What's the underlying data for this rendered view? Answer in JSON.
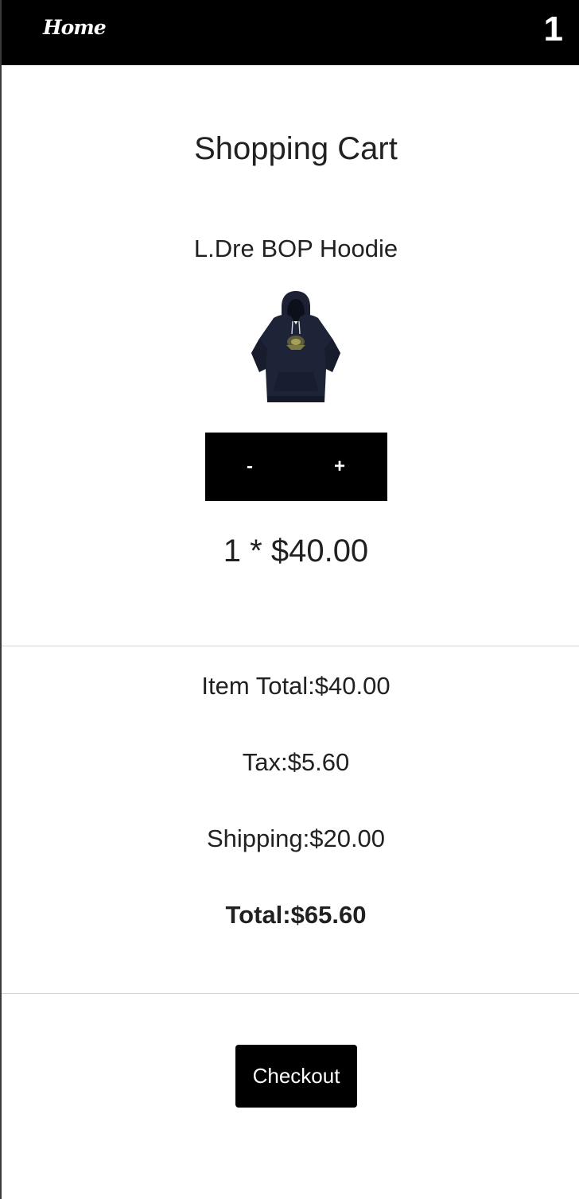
{
  "header": {
    "home_label": "Home",
    "cart_count": "1"
  },
  "page": {
    "title": "Shopping Cart"
  },
  "cart": {
    "items": [
      {
        "name": "L.Dre BOP Hoodie",
        "image_icon": "navy-hoodie-image",
        "decrement_label": "-",
        "increment_label": "+",
        "line_price": "1 * $40.00"
      }
    ]
  },
  "summary": {
    "item_total": "Item Total:$40.00",
    "tax": "Tax:$5.60",
    "shipping": "Shipping:$20.00",
    "total": "Total:$65.60"
  },
  "checkout": {
    "label": "Checkout"
  },
  "colors": {
    "header_bg": "#000000",
    "button_bg": "#000000",
    "text": "#212121",
    "divider": "#d6d6d6"
  }
}
